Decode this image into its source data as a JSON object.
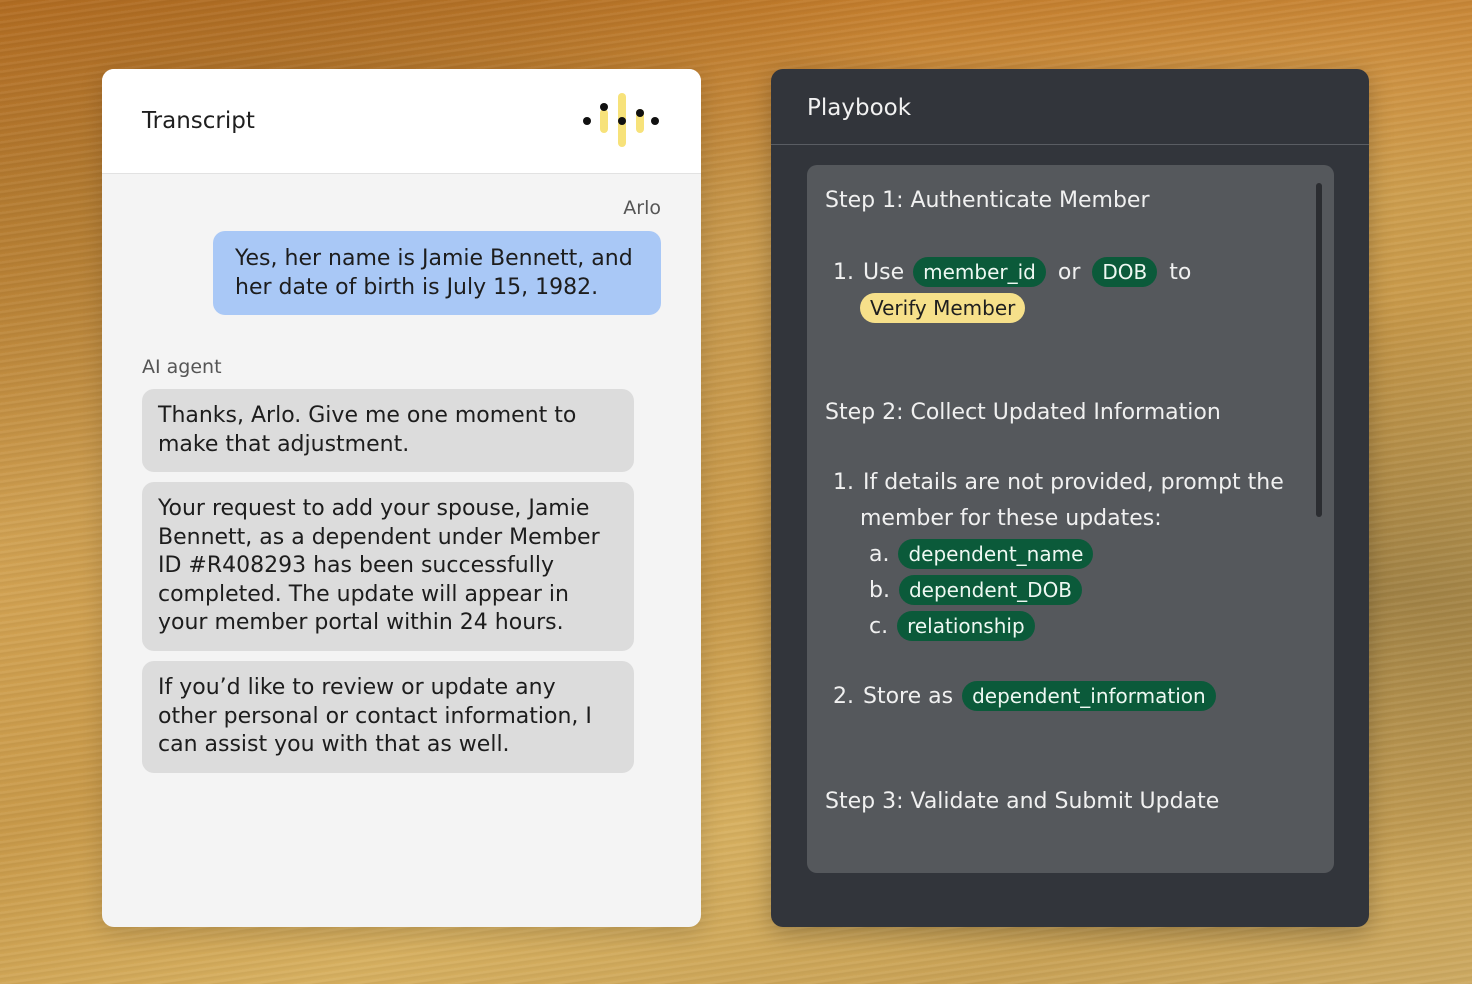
{
  "transcript": {
    "title": "Transcript",
    "user_speaker": "Arlo",
    "user_message": "Yes, her name is Jamie Bennett, and her date of birth is July 15, 1982.",
    "agent_speaker": "AI agent",
    "agent_messages": [
      "Thanks, Arlo. Give me one moment to make that adjustment.",
      "Your request to add your spouse, Jamie Bennett, as a dependent under Member ID #R408293 has been successfully completed. The update will appear in your member portal within 24 hours.",
      "If you’d like to review or update any other personal or contact information, I can assist you with that as well."
    ]
  },
  "playbook": {
    "title": "Playbook",
    "step1": {
      "title": "Step 1: Authenticate Member",
      "item1_num": "1.",
      "item1_use": "Use",
      "chip_member_id": "member_id",
      "or": "or",
      "chip_dob": "DOB",
      "to": "to",
      "chip_verify": "Verify Member"
    },
    "step2": {
      "title": "Step 2: Collect Updated Information",
      "item1_num": "1.",
      "item1_line1": "If details are not provided, prompt the",
      "item1_line2": "member for these updates:",
      "sub_a": "a.",
      "chip_a": "dependent_name",
      "sub_b": "b.",
      "chip_b": "dependent_DOB",
      "sub_c": "c.",
      "chip_c": "relationship",
      "item2_num": "2.",
      "item2_text": "Store as",
      "chip_store": "dependent_information"
    },
    "step3": {
      "title": "Step 3: Validate and Submit Update"
    }
  },
  "colors": {
    "user_bubble": "#a9c8f6",
    "agent_bubble": "#dcdcdc",
    "chip_green": "#0b5a3a",
    "chip_yellow": "#f6e08a",
    "playbook_bg": "#32353b"
  },
  "icons": {
    "transcript_logo": "audio-wave-icon"
  }
}
